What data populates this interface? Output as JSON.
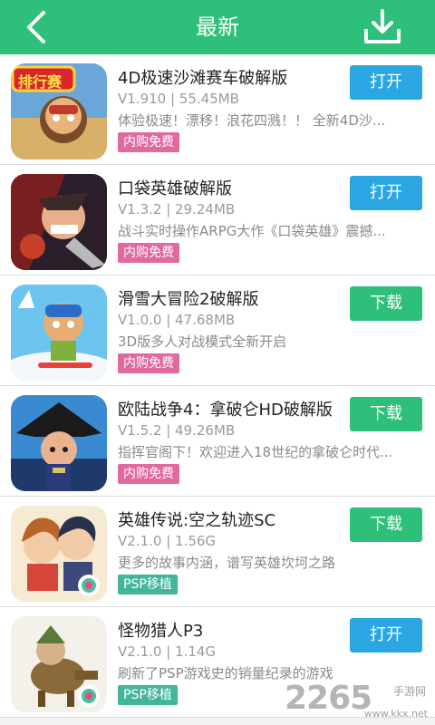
{
  "header": {
    "title": "最新",
    "bg_color": "#2ec07a",
    "back_icon": "back-chevron-icon",
    "download_icon": "download-icon"
  },
  "apps": [
    {
      "name": "4D极速沙滩赛车破解版",
      "meta": "V1.910 | 55.45MB",
      "desc": "体验极速！漂移！浪花四溅！！ 全新4D沙...",
      "tag": "内购免费",
      "button": "打开",
      "icon": "racing-game-icon",
      "thumb_text": "排行赛"
    },
    {
      "name": "口袋英雄破解版",
      "meta": "V1.3.2 | 29.24MB",
      "desc": "战斗实时操作ARPG大作《口袋英雄》震撼...",
      "tag": "内购免费",
      "button": "打开",
      "icon": "pocket-heroes-icon"
    },
    {
      "name": "滑雪大冒险2破解版",
      "meta": "V1.0.0 | 47.68MB",
      "desc": "3D版多人对战模式全新开启",
      "tag": "内购免费",
      "button": "下载",
      "icon": "ski-safari-icon"
    },
    {
      "name": "欧陆战争4：拿破仑HD破解版",
      "meta": "V1.5.2 | 49.26MB",
      "desc": "指挥官阁下！欢迎进入18世纪的拿破仑时代...",
      "tag": "内购免费",
      "button": "下载",
      "icon": "napoleon-icon"
    },
    {
      "name": "英雄传说:空之轨迹SC",
      "meta": "V2.1.0 | 1.56G",
      "desc": "更多的故事内涵，谱写英雄坎坷之路",
      "tag": "PSP移植",
      "button": "下载",
      "icon": "trails-in-the-sky-icon"
    },
    {
      "name": "怪物猎人P3",
      "meta": "V2.1.0 | 1.14G",
      "desc": "刷新了PSP游戏史的销量纪录的游戏",
      "tag": "PSP移植",
      "button": "打开",
      "icon": "monster-hunter-icon"
    }
  ],
  "watermark": {
    "number": "2265",
    "site": "手游网",
    "url": "www.kkx.net"
  }
}
